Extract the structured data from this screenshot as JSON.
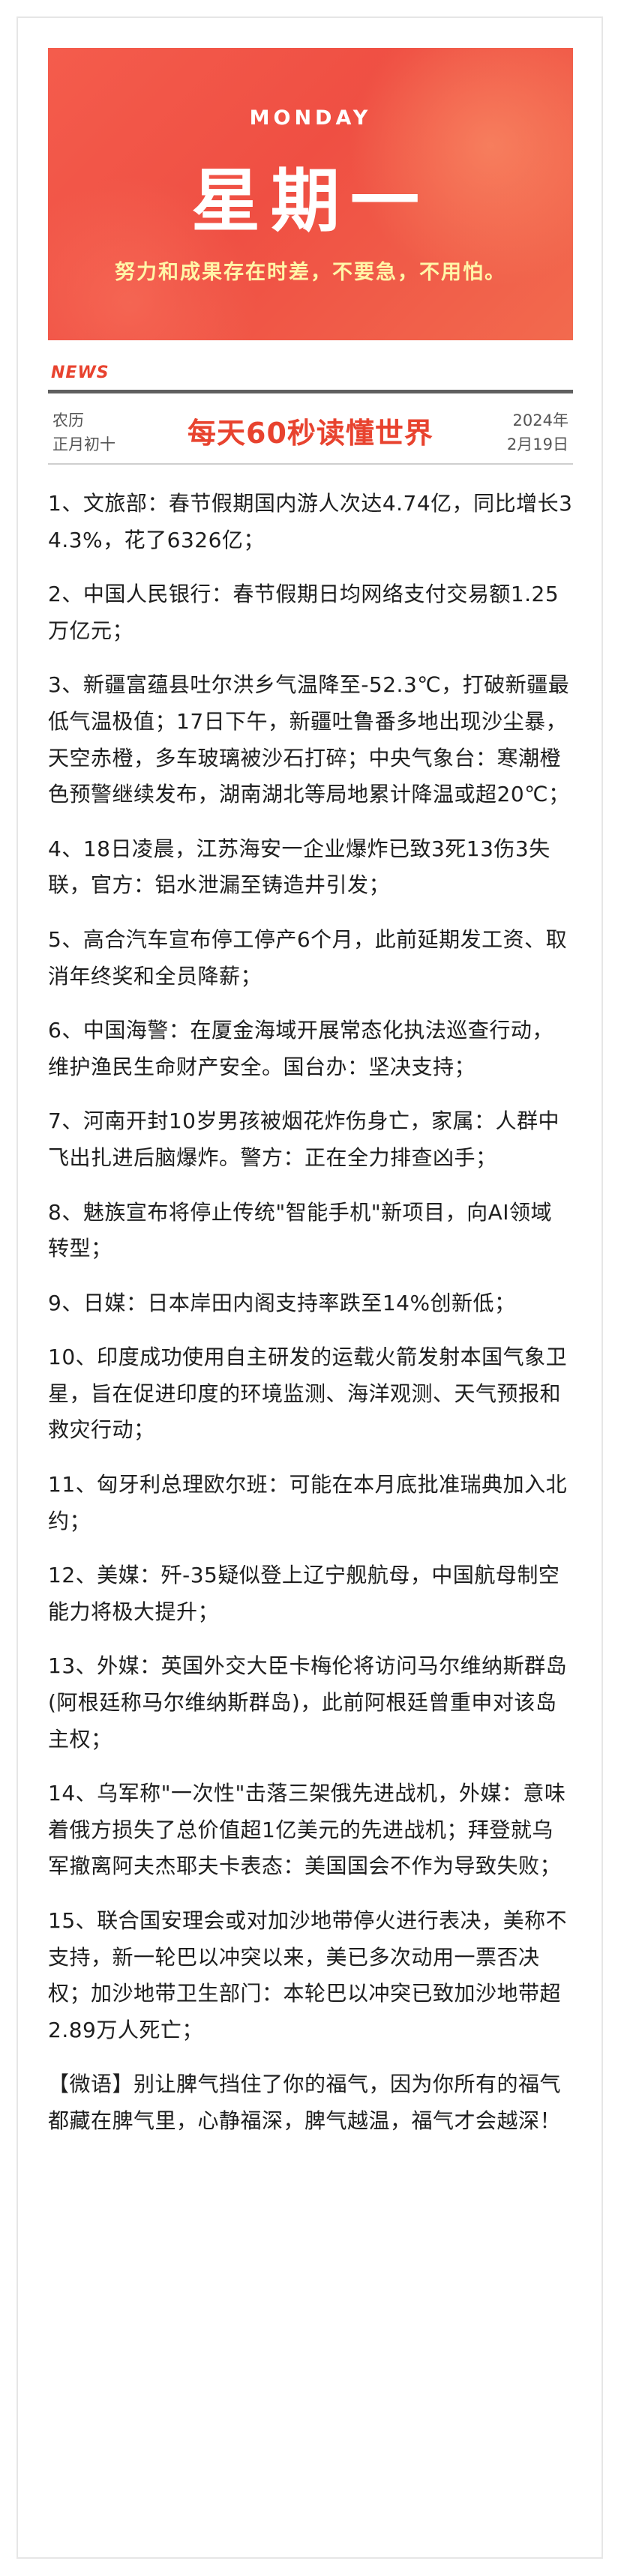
{
  "banner": {
    "weekday_en": "MONDAY",
    "weekday_cn": "星期一",
    "motto": "努力和成果存在时差，不要急，不用怕。"
  },
  "news_tag": "NEWS",
  "lunar": {
    "label": "农历",
    "date": "正月初十"
  },
  "headline": "每天60秒读懂世界",
  "solar": {
    "year": "2024年",
    "date": "2月19日"
  },
  "items": [
    "1、文旅部：春节假期国内游人次达4.74亿，同比增长34.3%，花了6326亿；",
    "2、中国人民银行：春节假期日均网络支付交易额1.25万亿元；",
    "3、新疆富蕴县吐尔洪乡气温降至-52.3℃，打破新疆最低气温极值；17日下午，新疆吐鲁番多地出现沙尘暴，天空赤橙，多车玻璃被沙石打碎；中央气象台：寒潮橙色预警继续发布，湖南湖北等局地累计降温或超20℃；",
    "4、18日凌晨，江苏海安一企业爆炸已致3死13伤3失联，官方：铝水泄漏至铸造井引发；",
    "5、高合汽车宣布停工停产6个月，此前延期发工资、取消年终奖和全员降薪；",
    "6、中国海警：在厦金海域开展常态化执法巡查行动，维护渔民生命财产安全。国台办：坚决支持；",
    "7、河南开封10岁男孩被烟花炸伤身亡，家属：人群中飞出扎进后脑爆炸。警方：正在全力排查凶手；",
    "8、魅族宣布将停止传统\"智能手机\"新项目，向AI领域转型；",
    "9、日媒：日本岸田内阁支持率跌至14%创新低；",
    "10、印度成功使用自主研发的运载火箭发射本国气象卫星，旨在促进印度的环境监测、海洋观测、天气预报和救灾行动；",
    "11、匈牙利总理欧尔班：可能在本月底批准瑞典加入北约；",
    "12、美媒：歼-35疑似登上辽宁舰航母，中国航母制空能力将极大提升；",
    "13、外媒：英国外交大臣卡梅伦将访问马尔维纳斯群岛(阿根廷称马尔维纳斯群岛)，此前阿根廷曾重申对该岛主权；",
    "14、乌军称\"一次性\"击落三架俄先进战机，外媒：意味着俄方损失了总价值超1亿美元的先进战机；拜登就乌军撤离阿夫杰耶夫卡表态：美国国会不作为导致失败；",
    "15、联合国安理会或对加沙地带停火进行表决，美称不支持，新一轮巴以冲突以来，美已多次动用一票否决权；加沙地带卫生部门：本轮巴以冲突已致加沙地带超2.89万人死亡；",
    "【微语】别让脾气挡住了你的福气，因为你所有的福气都藏在脾气里，心静福深，脾气越温，福气才会越深！"
  ]
}
